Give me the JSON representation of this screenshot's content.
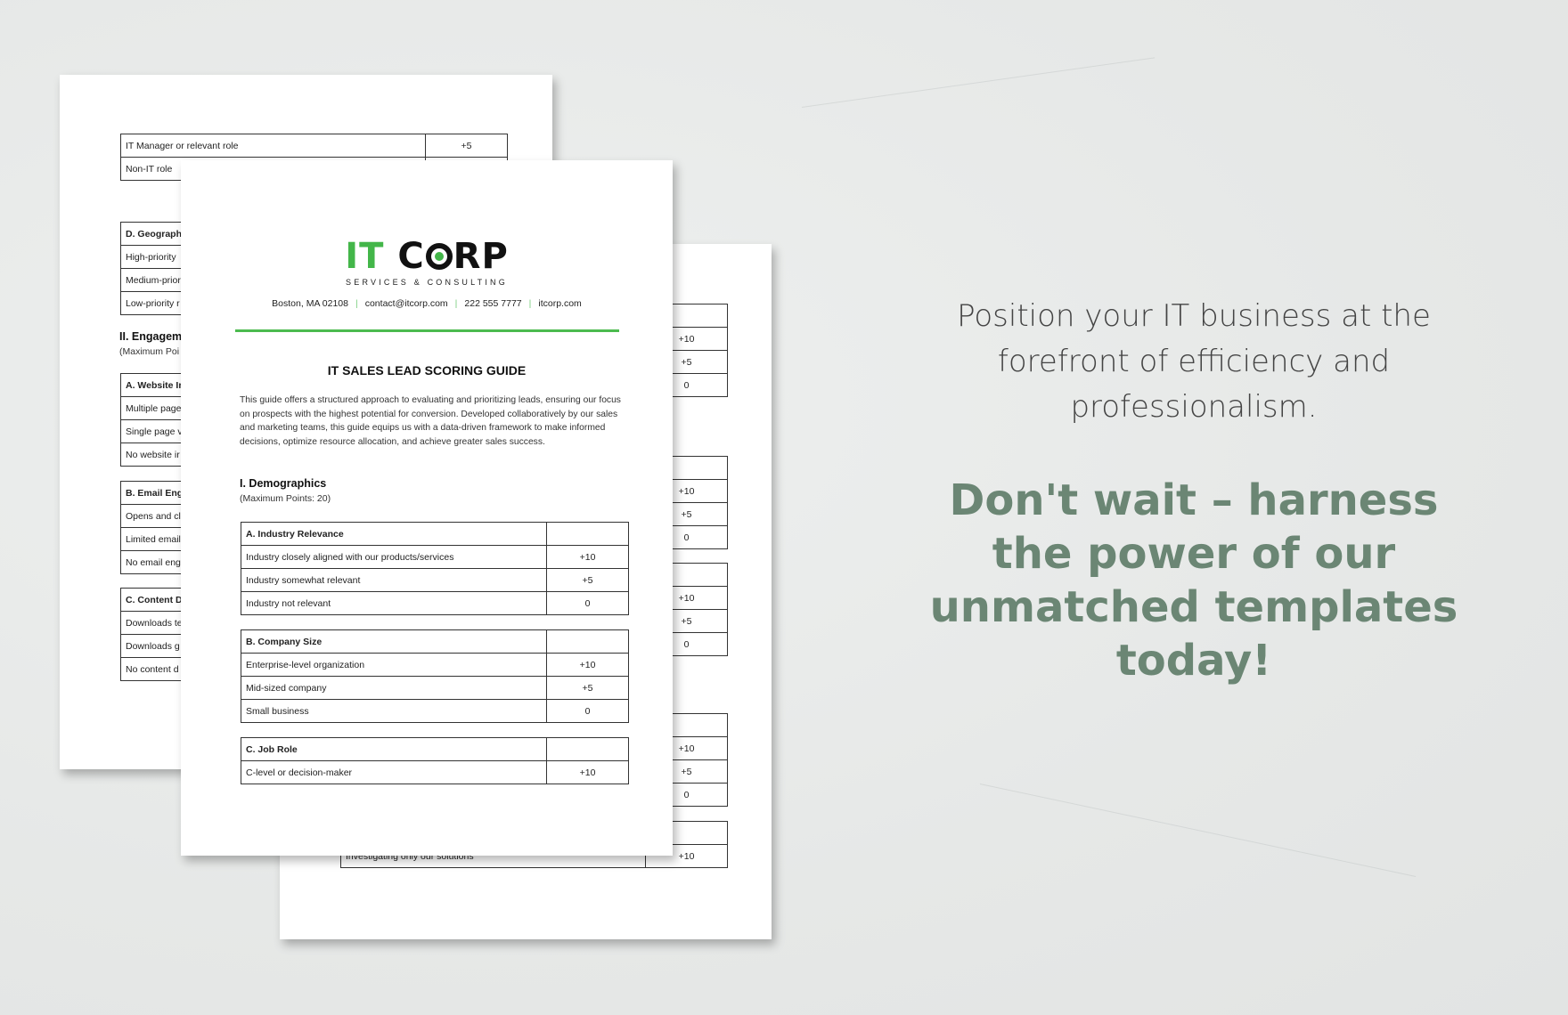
{
  "back_left_page": {
    "tables": [
      {
        "rows": [
          [
            "IT Manager or relevant role",
            "+5"
          ],
          [
            "Non-IT role",
            ""
          ]
        ]
      },
      {
        "rows": [
          [
            "D. Geograph",
            ""
          ],
          [
            "High-priority",
            ""
          ],
          [
            "Medium-prior",
            ""
          ],
          [
            "Low-priority r",
            ""
          ]
        ]
      },
      {
        "rows": [
          [
            "A. Website Ir",
            ""
          ],
          [
            "Multiple page",
            ""
          ],
          [
            "Single page v",
            ""
          ],
          [
            "No website ir",
            ""
          ]
        ]
      },
      {
        "rows": [
          [
            "B. Email Eng",
            ""
          ],
          [
            "Opens and cl",
            ""
          ],
          [
            "Limited email",
            ""
          ],
          [
            "No email eng",
            ""
          ]
        ]
      },
      {
        "rows": [
          [
            "C. Content D",
            ""
          ],
          [
            "Downloads te",
            ""
          ],
          [
            "Downloads g",
            ""
          ],
          [
            "No content d",
            ""
          ]
        ]
      }
    ],
    "section_title": "II. Engagem",
    "section_sub": "(Maximum Poi"
  },
  "back_right_page": {
    "tables": [
      {
        "rows": [
          [
            "",
            ""
          ],
          [
            "",
            "+10"
          ],
          [
            "",
            "+5"
          ],
          [
            "",
            "0"
          ]
        ]
      },
      {
        "rows": [
          [
            "",
            ""
          ],
          [
            "",
            "+10"
          ],
          [
            "",
            "+5"
          ],
          [
            "",
            "0"
          ]
        ]
      },
      {
        "rows": [
          [
            "",
            ""
          ],
          [
            "",
            "+10"
          ],
          [
            "",
            "+5"
          ],
          [
            "",
            "0"
          ]
        ]
      },
      {
        "rows": [
          [
            "",
            ""
          ],
          [
            "",
            "+10"
          ],
          [
            "",
            "+5"
          ],
          [
            "",
            "0"
          ]
        ]
      },
      {
        "rows": [
          [
            "",
            ""
          ],
          [
            "Investigating only our solutions",
            "+10"
          ]
        ]
      }
    ]
  },
  "front_page": {
    "logo": {
      "it": "IT",
      "corp_c": "C",
      "corp_rest": "RP",
      "tagline": "SERVICES & CONSULTING"
    },
    "contact": {
      "address": "Boston, MA 02108",
      "email": "contact@itcorp.com",
      "phone": "222 555 7777",
      "website": "itcorp.com"
    },
    "title": "IT SALES LEAD SCORING GUIDE",
    "intro": "This guide offers a structured approach to evaluating and prioritizing leads, ensuring our focus on prospects with the highest potential for conversion. Developed collaboratively by our sales and marketing teams, this guide equips us with a data-driven framework to make informed decisions, optimize resource allocation, and achieve greater sales success.",
    "section_title": "I. Demographics",
    "section_sub": "(Maximum Points: 20)",
    "tables": [
      {
        "rows": [
          [
            "A. Industry Relevance",
            ""
          ],
          [
            "Industry closely aligned with our products/services",
            "+10"
          ],
          [
            "Industry somewhat relevant",
            "+5"
          ],
          [
            "Industry not relevant",
            "0"
          ]
        ]
      },
      {
        "rows": [
          [
            "B. Company Size",
            ""
          ],
          [
            "Enterprise-level organization",
            "+10"
          ],
          [
            "Mid-sized company",
            "+5"
          ],
          [
            "Small business",
            "0"
          ]
        ]
      },
      {
        "rows": [
          [
            "C. Job Role",
            ""
          ],
          [
            "C-level or decision-maker",
            "+10"
          ]
        ]
      }
    ]
  },
  "promo": {
    "tagline": "Position your IT business at the forefront of efficiency and professionalism.",
    "cta": "Don't wait – harness the power of our unmatched templates today!"
  },
  "colors": {
    "brand_green": "#43b649",
    "cta_green": "#6b8674",
    "background": "#e8eaea"
  }
}
